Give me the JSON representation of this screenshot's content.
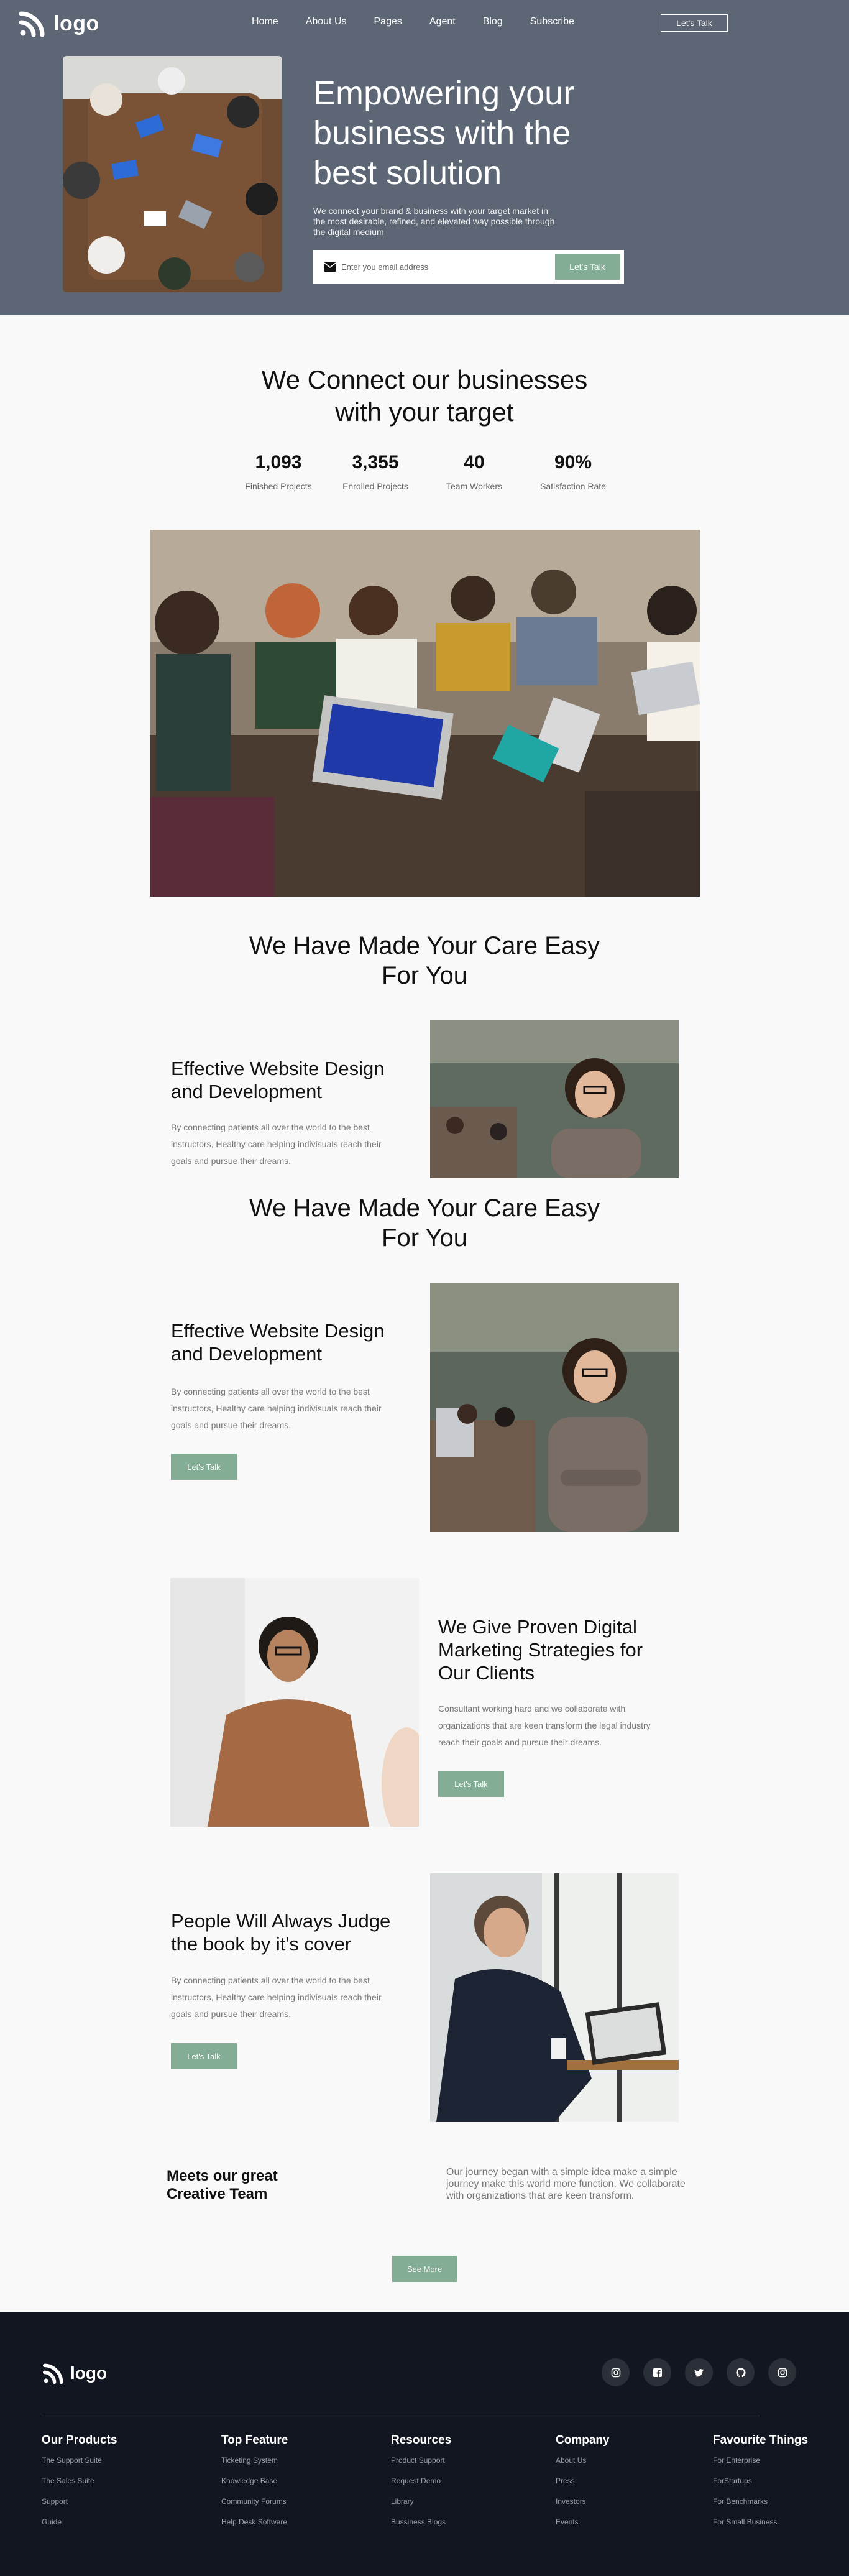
{
  "nav": {
    "logo": "logo",
    "items": [
      "Home",
      "About Us",
      "Pages",
      "Agent",
      "Blog",
      "Subscribe"
    ],
    "cta": "Let's Talk"
  },
  "hero": {
    "title": "Empowering your business with the best solution",
    "subtitle": "We connect your brand & business with your target market in the most desirable, refined, and elevated way possible through the digital medium",
    "email_placeholder": "Enter you email address",
    "cta": "Let's Talk"
  },
  "connect": {
    "title": "We Connect our businesses with your target",
    "stats": [
      {
        "value": "1,093",
        "label": "Finished Projects"
      },
      {
        "value": "3,355",
        "label": "Enrolled Projects"
      },
      {
        "value": "40",
        "label": "Team Workers"
      },
      {
        "value": "90%",
        "label": "Satisfaction Rate"
      }
    ]
  },
  "care1": {
    "title": "We Have Made Your Care Easy For You",
    "feature_title": "Effective Website Design and Development",
    "feature_text": "By connecting patients all over the world to the best instructors, Healthy care helping indivisuals reach their goals and pursue their dreams."
  },
  "care2": {
    "title": "We Have Made Your Care Easy For You",
    "feature_title": "Effective Website Design and Development",
    "feature_text": "By connecting patients all over the world to the best instructors, Healthy care helping indivisuals reach their goals and pursue their dreams.",
    "cta": "Let's Talk"
  },
  "marketing": {
    "title": "We Give Proven Digital Marketing Strategies for Our Clients",
    "text": "Consultant working hard and we collaborate with organizations that are keen transform the legal industry reach their goals and pursue their dreams.",
    "cta": "Let's Talk"
  },
  "judge": {
    "title": "People Will Always Judge the book by it's cover",
    "text": "By connecting patients all over the world to the best instructors, Healthy care helping indivisuals reach their goals and pursue their dreams.",
    "cta": "Let's Talk"
  },
  "team": {
    "title": "Meets our great Creative Team",
    "description": "Our journey began with a simple idea make a simple journey make this world more function. We collaborate with organizations that are keen transform.",
    "see_more": "See More"
  },
  "footer": {
    "logo": "logo",
    "socials": [
      "instagram-icon",
      "facebook-icon",
      "twitter-icon",
      "github-icon",
      "instagram-icon"
    ],
    "columns": [
      {
        "title": "Our Products",
        "items": [
          "The Support Suite",
          "The Sales Suite",
          "Support",
          "Guide"
        ]
      },
      {
        "title": "Top Feature",
        "items": [
          "Ticketing System",
          "Knowledge Base",
          "Community Forums",
          "Help Desk Software"
        ]
      },
      {
        "title": "Resources",
        "items": [
          "Product Support",
          "Request Demo",
          "Library",
          "Bussiness Blogs"
        ]
      },
      {
        "title": "Company",
        "items": [
          "About Us",
          "Press",
          "Investors",
          "Events"
        ]
      },
      {
        "title": "Favourite Things",
        "items": [
          "For Enterprise",
          "ForStartups",
          "For Benchmarks",
          "For Small Business"
        ]
      }
    ]
  },
  "colors": {
    "hero_bg": "#5d6674",
    "accent": "#84ad96",
    "footer_bg": "#111620"
  }
}
